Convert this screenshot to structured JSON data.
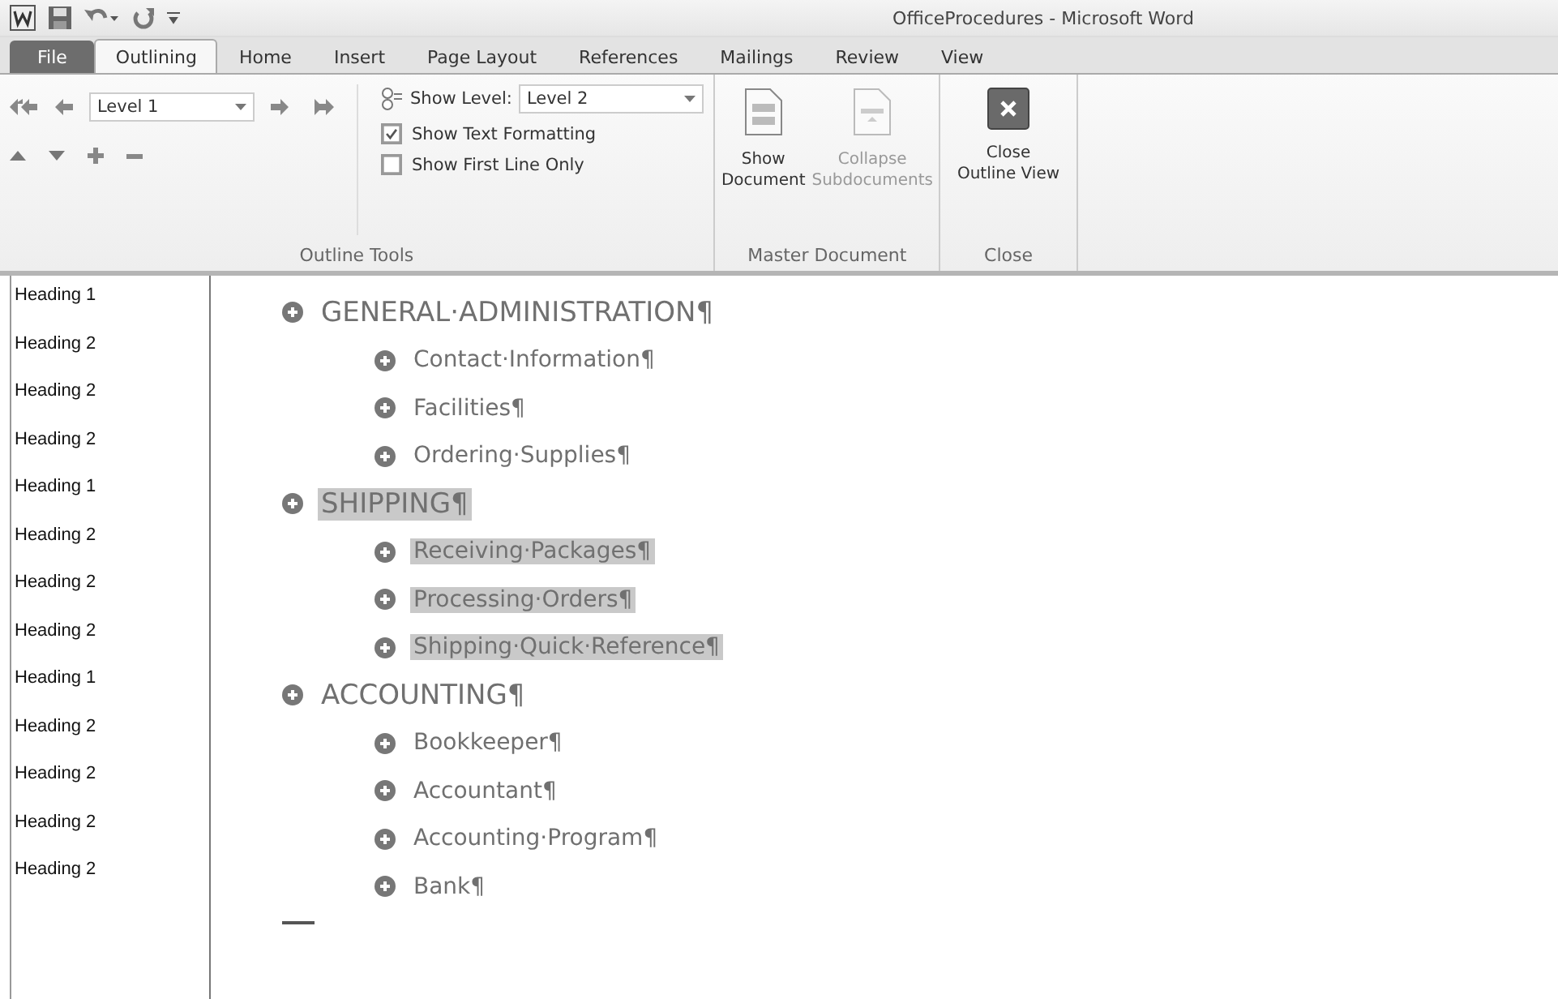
{
  "window": {
    "title": "OfficeProcedures - Microsoft Word"
  },
  "tabs": [
    {
      "label": "File",
      "kind": "file",
      "selected": false
    },
    {
      "label": "Outlining",
      "kind": "tab",
      "selected": true
    },
    {
      "label": "Home",
      "kind": "tab",
      "selected": false
    },
    {
      "label": "Insert",
      "kind": "tab",
      "selected": false
    },
    {
      "label": "Page Layout",
      "kind": "tab",
      "selected": false
    },
    {
      "label": "References",
      "kind": "tab",
      "selected": false
    },
    {
      "label": "Mailings",
      "kind": "tab",
      "selected": false
    },
    {
      "label": "Review",
      "kind": "tab",
      "selected": false
    },
    {
      "label": "View",
      "kind": "tab",
      "selected": false
    }
  ],
  "ribbon": {
    "outline_tools": {
      "label": "Outline Tools",
      "outline_level": "Level 1",
      "show_level_label": "Show Level:",
      "show_level": "Level 2",
      "options": [
        {
          "label": "Show Text Formatting",
          "checked": true
        },
        {
          "label": "Show First Line Only",
          "checked": false
        }
      ]
    },
    "master_document": {
      "label": "Master Document",
      "buttons": [
        {
          "label": "Show Document",
          "disabled": false
        },
        {
          "label": "Collapse Subdocuments",
          "disabled": true
        }
      ]
    },
    "close": {
      "label": "Close",
      "button": "Close Outline View"
    }
  },
  "style_area": [
    "Heading 1",
    "Heading 2",
    "Heading 2",
    "Heading 2",
    "Heading 1",
    "Heading 2",
    "Heading 2",
    "Heading 2",
    "Heading 1",
    "Heading 2",
    "Heading 2",
    "Heading 2",
    "Heading 2"
  ],
  "outline": [
    {
      "text": "GENERAL·ADMINISTRATION¶",
      "selected": false,
      "children": [
        {
          "text": "Contact·Information¶",
          "selected": false
        },
        {
          "text": "Facilities¶",
          "selected": false
        },
        {
          "text": "Ordering·Supplies¶",
          "selected": false
        }
      ]
    },
    {
      "text": "SHIPPING¶",
      "selected": true,
      "children": [
        {
          "text": "Receiving·Packages¶",
          "selected": true
        },
        {
          "text": "Processing·Orders¶",
          "selected": true
        },
        {
          "text": "Shipping·Quick·Reference¶",
          "selected": true
        }
      ]
    },
    {
      "text": "ACCOUNTING¶",
      "selected": false,
      "children": [
        {
          "text": "Bookkeeper¶",
          "selected": false
        },
        {
          "text": "Accountant¶",
          "selected": false
        },
        {
          "text": "Accounting·Program¶",
          "selected": false
        },
        {
          "text": "Bank¶",
          "selected": false
        }
      ]
    }
  ]
}
